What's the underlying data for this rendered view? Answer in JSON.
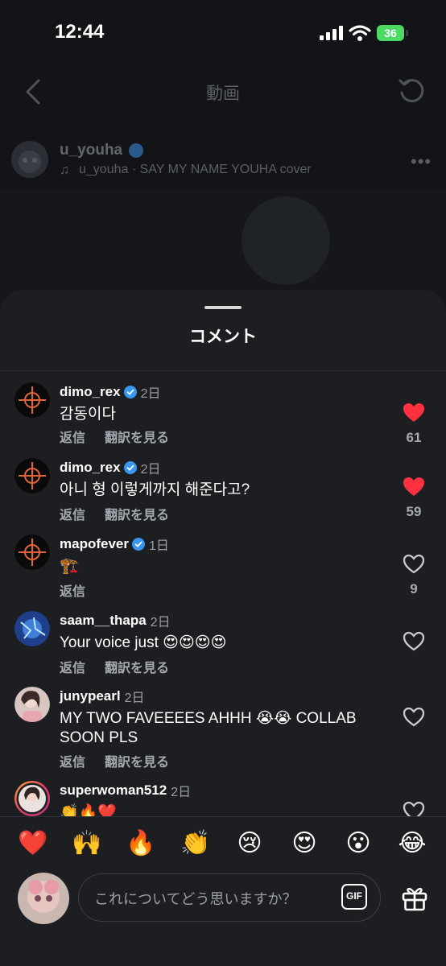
{
  "status": {
    "time": "12:44",
    "battery": "36"
  },
  "nav": {
    "title": "動画"
  },
  "post": {
    "username": "u_youha",
    "audio": "u_youha · SAY MY NAME YOUHA cover"
  },
  "sheet": {
    "title": "コメント"
  },
  "labels": {
    "reply": "返信",
    "translate": "翻訳を見る"
  },
  "comments": [
    {
      "user": "dimo_rex",
      "verified": true,
      "time": "2日",
      "text": "감동이다",
      "liked": true,
      "likes": "61",
      "translate": true
    },
    {
      "user": "dimo_rex",
      "verified": true,
      "time": "2日",
      "text": "아니 형 이렇게까지 해준다고?",
      "liked": true,
      "likes": "59",
      "translate": true
    },
    {
      "user": "mapofever",
      "verified": true,
      "time": "1日",
      "text": "🏗️",
      "liked": false,
      "likes": "9",
      "translate": false
    },
    {
      "user": "saam__thapa",
      "verified": false,
      "time": "2日",
      "text": "Your voice just 😍😍😍😍",
      "liked": false,
      "likes": "",
      "translate": true
    },
    {
      "user": "junypearl",
      "verified": false,
      "time": "2日",
      "text": "MY TWO FAVEEEES AHHH 😭😭 COLLAB SOON PLS",
      "liked": false,
      "likes": "",
      "translate": true
    },
    {
      "user": "superwoman512",
      "verified": false,
      "time": "2日",
      "text": "👏🔥❤️",
      "liked": false,
      "likes": "",
      "translate": false
    }
  ],
  "quick_reactions": [
    "❤️",
    "🙌",
    "🔥",
    "👏",
    "😢",
    "😍",
    "😮",
    "😂"
  ],
  "input": {
    "placeholder": "これについてどう思いますか？",
    "gif_label": "GIF"
  },
  "colors": {
    "like_red": "#ff3040",
    "verified_blue": "#3897f0",
    "sheet_bg": "#1c1e22"
  },
  "icons": [
    "back-icon",
    "refresh-icon",
    "music-note-icon",
    "more-icon",
    "heart-icon",
    "verified-icon",
    "gif-icon",
    "gift-icon"
  ]
}
